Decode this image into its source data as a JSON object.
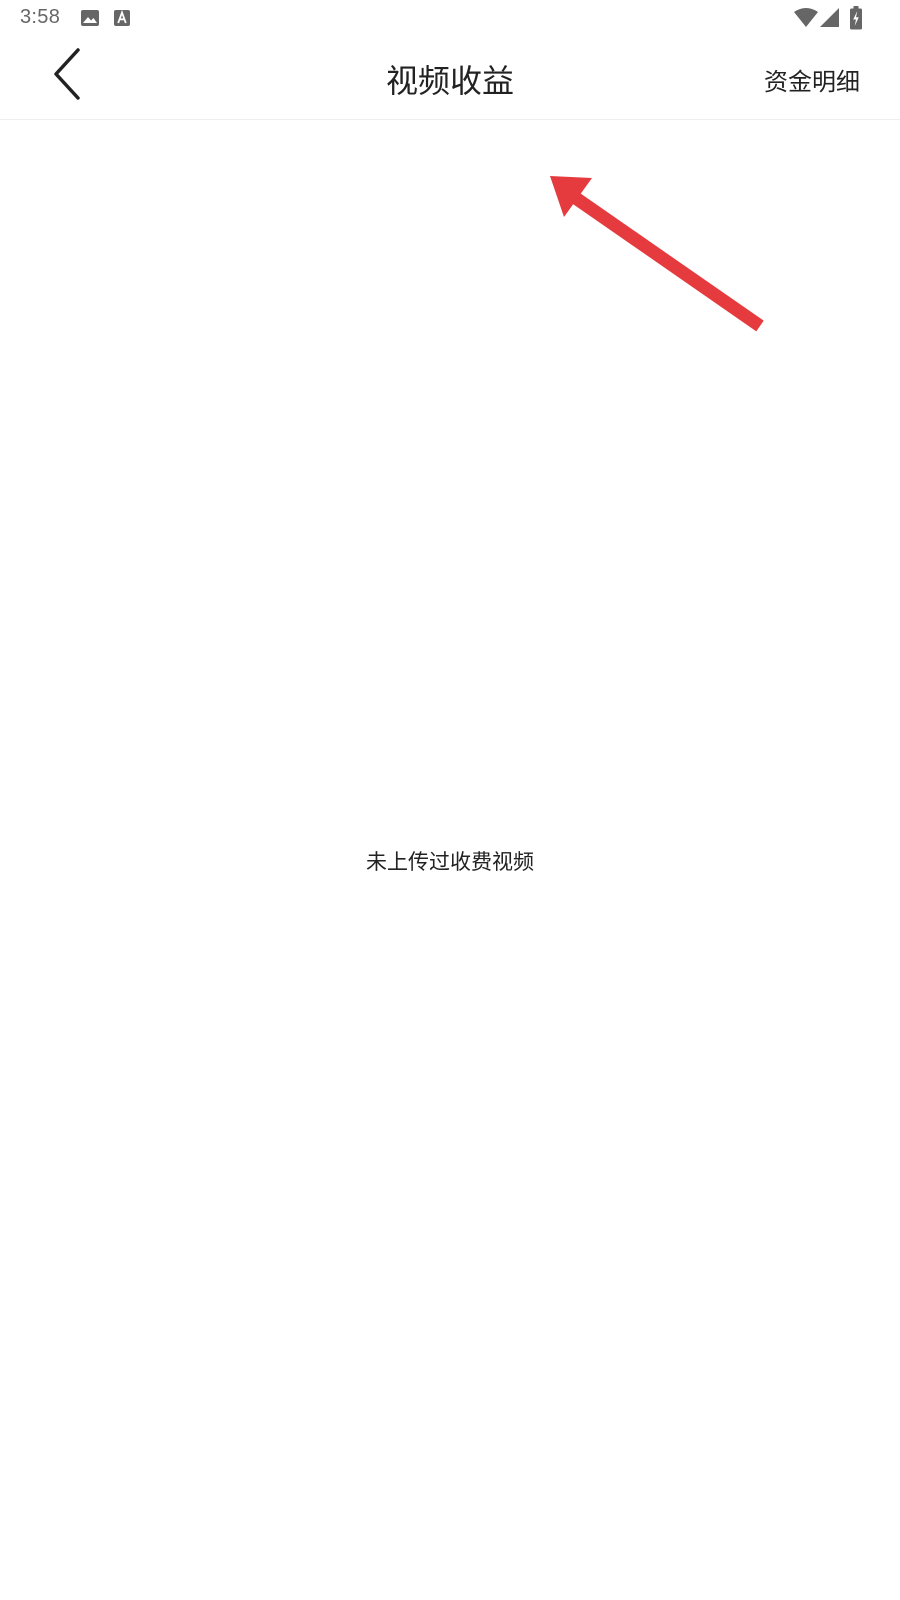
{
  "status_bar": {
    "time": "3:58",
    "icons_left": [
      "image-icon",
      "font-a-icon"
    ],
    "icons_right": [
      "wifi-icon",
      "cellular-signal-icon",
      "battery-charging-icon"
    ]
  },
  "app_bar": {
    "title": "视频收益",
    "back_icon": "chevron-left-icon",
    "action_label": "资金明细"
  },
  "content": {
    "empty_message": "未上传过收费视频"
  },
  "annotation": {
    "arrow_color": "#e53b3f"
  },
  "colors": {
    "background": "#ffffff",
    "text_primary": "#222222",
    "status_text": "#666666",
    "divider": "#efefef"
  }
}
